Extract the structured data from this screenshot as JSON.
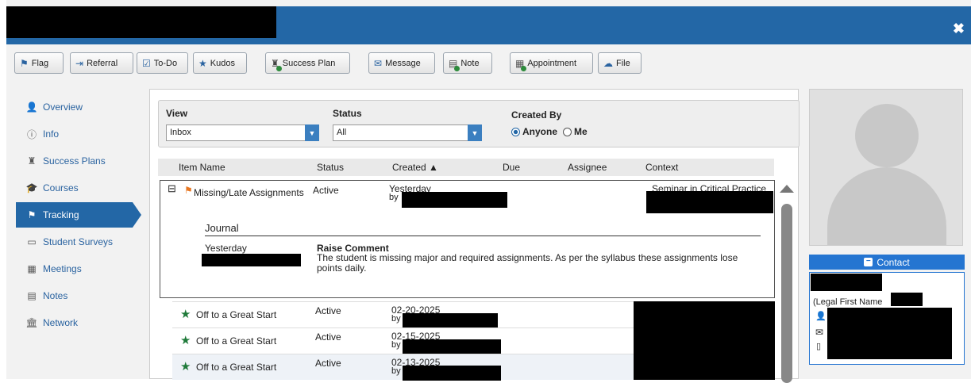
{
  "window": {
    "close_icon": "✖"
  },
  "toolbar": {
    "flag": "Flag",
    "referral": "Referral",
    "todo": "To-Do",
    "kudos": "Kudos",
    "success_plan": "Success Plan",
    "message": "Message",
    "note": "Note",
    "appointment": "Appointment",
    "file": "File"
  },
  "sidebar": {
    "items": [
      {
        "label": "Overview",
        "icon": "user-icon"
      },
      {
        "label": "Info",
        "icon": "info-icon"
      },
      {
        "label": "Success Plans",
        "icon": "success-plan-icon"
      },
      {
        "label": "Courses",
        "icon": "graduation-cap-icon"
      },
      {
        "label": "Tracking",
        "icon": "flag-icon",
        "active": true
      },
      {
        "label": "Student Surveys",
        "icon": "survey-icon"
      },
      {
        "label": "Meetings",
        "icon": "calendar-icon"
      },
      {
        "label": "Notes",
        "icon": "note-icon"
      },
      {
        "label": "Network",
        "icon": "institution-icon"
      }
    ]
  },
  "filters": {
    "view_label": "View",
    "view_value": "Inbox",
    "status_label": "Status",
    "status_value": "All",
    "created_by_label": "Created By",
    "anyone": "Anyone",
    "me": "Me",
    "selected": "Anyone"
  },
  "table": {
    "headers": [
      "Item Name",
      "Status",
      "Created ▲",
      "Due",
      "Assignee",
      "Context"
    ],
    "expanded": {
      "name": "Missing/Late Assignments",
      "status": "Active",
      "created": "Yesterday",
      "by": "by",
      "context": "Seminar in Critical Practice",
      "journal_title": "Journal",
      "entry_date": "Yesterday",
      "entry_type": "Raise Comment",
      "entry_text": "The student is missing major and required assignments. As per the syllabus these assignments lose points daily."
    },
    "rows": [
      {
        "name": "Off to a Great Start",
        "status": "Active",
        "created": "02-20-2025",
        "by": "by"
      },
      {
        "name": "Off to a Great Start",
        "status": "Active",
        "created": "02-15-2025",
        "by": "by"
      },
      {
        "name": "Off to a Great Start",
        "status": "Active",
        "created": "02-13-2025",
        "by": "by"
      }
    ]
  },
  "contact": {
    "header": "Contact",
    "legal_first_name": "(Legal First Name"
  },
  "colors": {
    "titlebar": "#2367a6",
    "active_nav": "#2367a6",
    "flag_orange": "#e87722",
    "kudos_green": "#1f7a3a",
    "contact_blue": "#2575d1"
  }
}
